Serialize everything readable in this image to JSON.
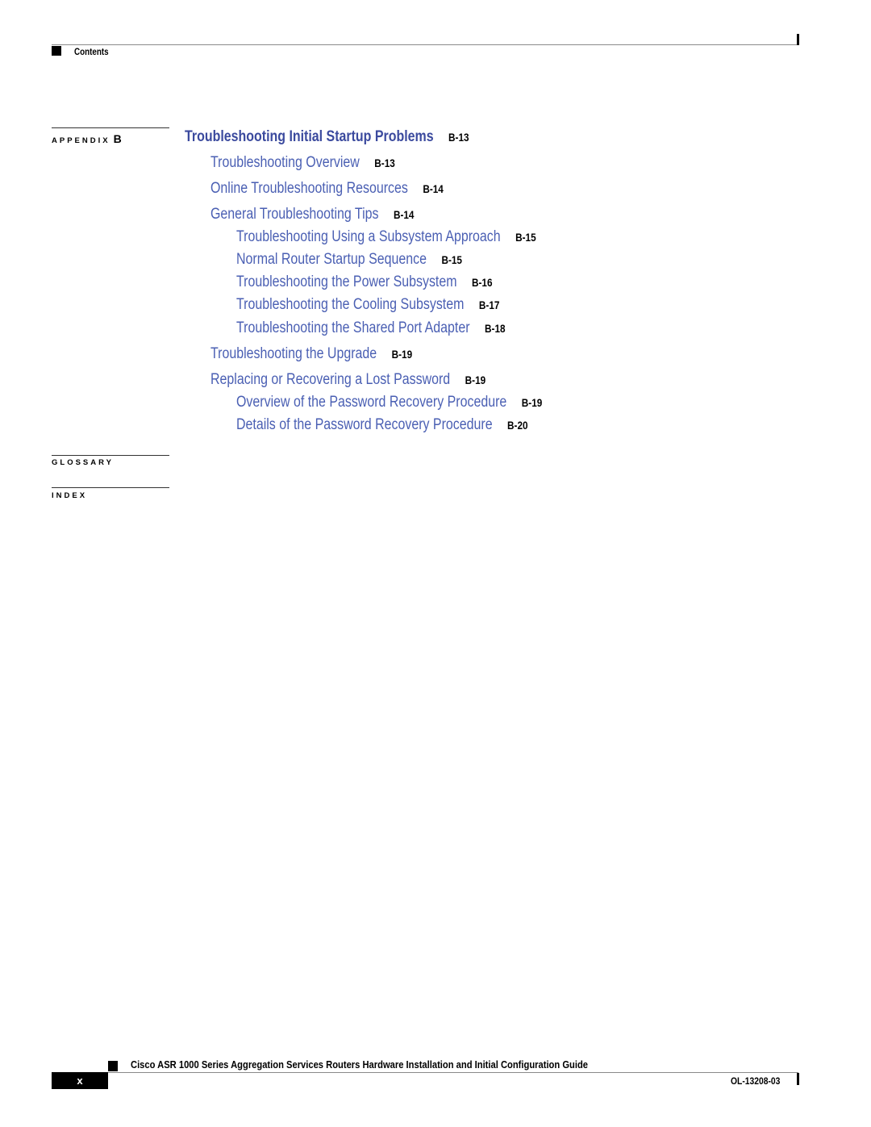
{
  "header": {
    "section_label": "Contents"
  },
  "sidebar": {
    "appendix": {
      "label": "APPENDIX",
      "letter": "B"
    },
    "glossary": {
      "label": "GLOSSARY"
    },
    "index": {
      "label": "INDEX"
    }
  },
  "toc": {
    "entries": [
      {
        "level": 1,
        "title": "Troubleshooting Initial Startup Problems",
        "page": "B-13"
      },
      {
        "level": 2,
        "title": "Troubleshooting Overview",
        "page": "B-13"
      },
      {
        "level": 2,
        "title": "Online Troubleshooting Resources",
        "page": "B-14"
      },
      {
        "level": 2,
        "title": "General Troubleshooting Tips",
        "page": "B-14"
      },
      {
        "level": 3,
        "title": "Troubleshooting Using a Subsystem Approach",
        "page": "B-15"
      },
      {
        "level": 3,
        "title": "Normal Router Startup Sequence",
        "page": "B-15"
      },
      {
        "level": 3,
        "title": "Troubleshooting the Power Subsystem",
        "page": "B-16"
      },
      {
        "level": 3,
        "title": "Troubleshooting the Cooling Subsystem",
        "page": "B-17"
      },
      {
        "level": 3,
        "title": "Troubleshooting the Shared Port Adapter",
        "page": "B-18"
      },
      {
        "level": 2,
        "title": "Troubleshooting the Upgrade",
        "page": "B-19"
      },
      {
        "level": 2,
        "title": "Replacing or Recovering a Lost Password",
        "page": "B-19"
      },
      {
        "level": 3,
        "title": "Overview of the Password Recovery Procedure",
        "page": "B-19"
      },
      {
        "level": 3,
        "title": "Details of the Password Recovery Procedure",
        "page": "B-20"
      }
    ]
  },
  "footer": {
    "guide_title": "Cisco ASR 1000 Series Aggregation Services Routers Hardware Installation and Initial Configuration Guide",
    "page_number": "x",
    "doc_number": "OL-13208-03"
  },
  "colors": {
    "heading_blue": "#3b4a9e",
    "link_blue": "#4a5fb3"
  }
}
